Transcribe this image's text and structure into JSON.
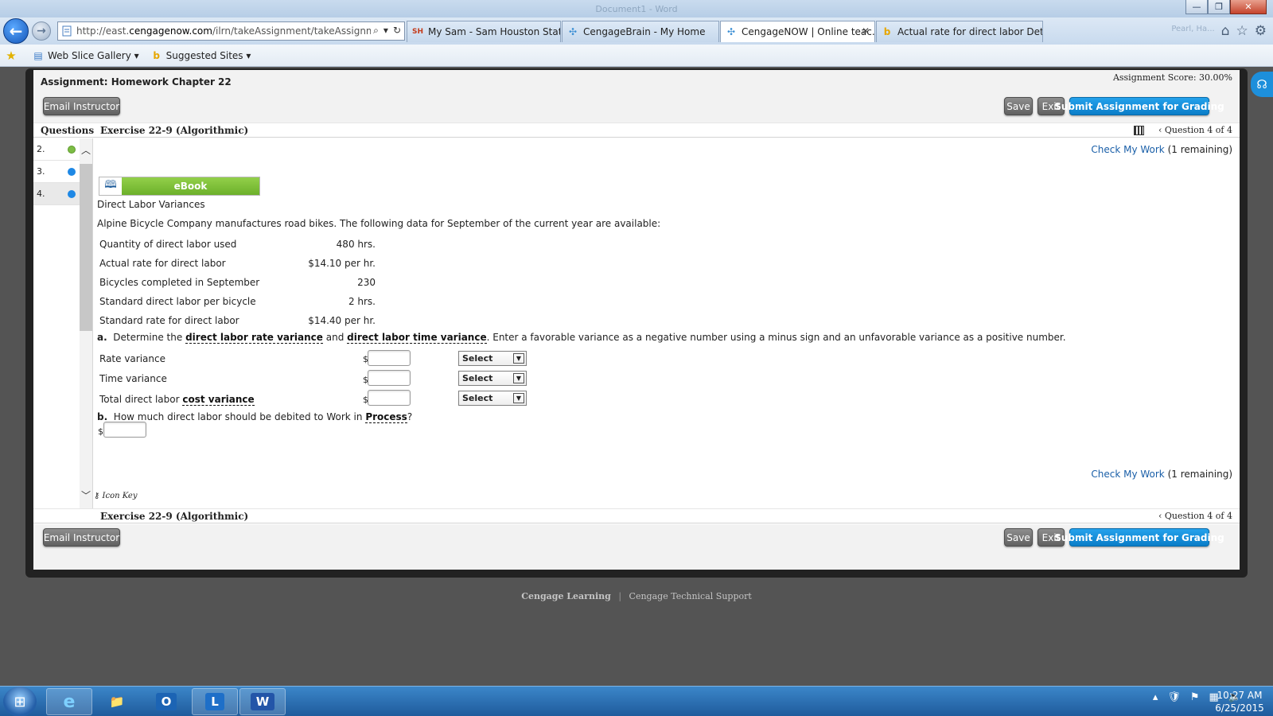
{
  "window": {
    "title": "Document1 - Word",
    "buttons": [
      "—",
      "❐",
      "✕"
    ]
  },
  "browser": {
    "url_prefix": "http://east.",
    "url_domain": "cengagenow.com",
    "url_path": "/ilrn/takeAssignment/takeAssignmentI",
    "tabs": [
      {
        "label": "My Sam - Sam Houston State ...",
        "icon": "SH"
      },
      {
        "label": "CengageBrain - My Home",
        "icon": "✣"
      },
      {
        "label": "CengageNOW | Online teac...",
        "icon": "✣",
        "close": "✕"
      },
      {
        "label": "Actual rate for direct labor Det...",
        "icon": "b"
      }
    ],
    "user_hint": "Pearl, Ha...",
    "favorites": [
      {
        "label": "Web Slice Gallery ▾"
      },
      {
        "label": "Suggested Sites ▾"
      }
    ]
  },
  "assignment": {
    "title": "Assignment: Homework Chapter 22",
    "score": "Assignment Score: 30.00%",
    "buttons": {
      "email": "Email Instructor",
      "save": "Save",
      "exit": "Exit",
      "submit": "Submit Assignment for Grading"
    },
    "questions_label": "Questions",
    "exercise": "Exercise 22-9 (Algorithmic)",
    "question_position": "Question 4 of 4",
    "question_items": [
      {
        "num": "2.",
        "status": "done"
      },
      {
        "num": "3.",
        "status": "open"
      },
      {
        "num": "4.",
        "status": "open"
      }
    ],
    "check_my_work": "Check My Work",
    "remaining": "(1 remaining)",
    "ebook": "eBook",
    "icon_key": "Icon Key"
  },
  "problem": {
    "heading": "Direct Labor Variances",
    "intro": "Alpine Bicycle Company manufactures road bikes. The following data for September of the current year are available:",
    "data_rows": [
      {
        "label": "Quantity of direct labor used",
        "value": "480 hrs."
      },
      {
        "label": "Actual rate for direct labor",
        "value": "$14.10 per hr."
      },
      {
        "label": "Bicycles completed in September",
        "value": "230"
      },
      {
        "label": "Standard direct labor per bicycle",
        "value": "2 hrs."
      },
      {
        "label": "Standard rate for direct labor",
        "value": "$14.40 per hr."
      }
    ],
    "part_a": {
      "letter": "a.",
      "text_1": "Determine the",
      "term_1": "direct labor rate variance",
      "text_2": "and",
      "term_2": "direct labor time variance",
      "text_3": ". Enter a favorable variance as a negative number using a minus sign and an unfavorable variance as a positive number."
    },
    "answer_rows": [
      {
        "label": "Rate variance",
        "currency": "$",
        "value": "",
        "select": "Select"
      },
      {
        "label": "Time variance",
        "currency": "$",
        "value": "",
        "select": "Select"
      },
      {
        "label_plain": "Total direct labor",
        "label_term": "cost variance",
        "currency": "$",
        "value": "",
        "select": "Select"
      }
    ],
    "part_b": {
      "letter": "b.",
      "text": "How much direct labor should be debited to Work in",
      "term": "Process",
      "tail": "?",
      "currency": "$",
      "value": ""
    }
  },
  "footer": {
    "brand": "Cengage Learning",
    "separator": "|",
    "support": "Cengage Technical Support"
  },
  "taskbar": {
    "apps": [
      "e",
      "📁",
      "O",
      "L",
      "W"
    ],
    "time": "10:27 AM",
    "date": "6/25/2015"
  },
  "colors": {
    "accent_blue": "#0a7dc8",
    "ebook_green": "#7cbc45",
    "link_blue": "#1a5fa8"
  }
}
